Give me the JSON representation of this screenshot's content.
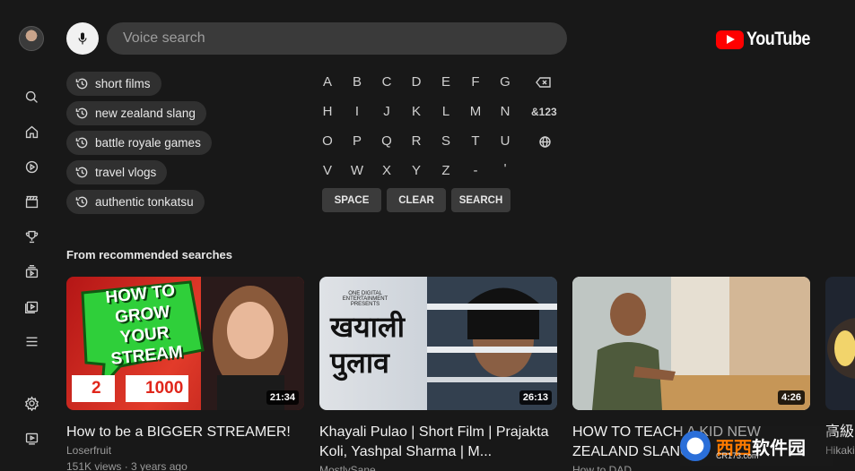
{
  "search": {
    "placeholder": "Voice search",
    "mic_icon": "microphone-icon"
  },
  "logo": {
    "text": "YouTube",
    "brand_color": "#ff0000"
  },
  "rail": {
    "items": [
      {
        "icon": "search-icon"
      },
      {
        "icon": "home-icon"
      },
      {
        "icon": "shorts-icon"
      },
      {
        "icon": "movies-icon"
      },
      {
        "icon": "trophy-icon"
      },
      {
        "icon": "subscriptions-icon"
      },
      {
        "icon": "library-icon"
      },
      {
        "icon": "menu-icon"
      },
      {
        "icon": "settings-icon"
      },
      {
        "icon": "cast-icon"
      }
    ]
  },
  "history": [
    {
      "label": "short films"
    },
    {
      "label": "new zealand slang"
    },
    {
      "label": "battle royale games"
    },
    {
      "label": "travel vlogs"
    },
    {
      "label": "authentic tonkatsu"
    }
  ],
  "keyboard": {
    "rows": [
      [
        "A",
        "B",
        "C",
        "D",
        "E",
        "F",
        "G"
      ],
      [
        "H",
        "I",
        "J",
        "K",
        "L",
        "M",
        "N"
      ],
      [
        "O",
        "P",
        "Q",
        "R",
        "S",
        "T",
        "U"
      ],
      [
        "V",
        "W",
        "X",
        "Y",
        "Z",
        "-",
        "'"
      ]
    ],
    "symbols_label": "&123",
    "space_label": "SPACE",
    "clear_label": "CLEAR",
    "search_label": "SEARCH"
  },
  "recommended": {
    "title": "From recommended searches",
    "videos": [
      {
        "title": "How to be a BIGGER STREAMER!",
        "channel": "Loserfruit",
        "meta": "151K views · 3 years ago",
        "duration": "21:34",
        "thumb_text_1": "HOW TO",
        "thumb_text_2": "GROW YOUR",
        "thumb_text_3": "STREAM",
        "thumb_stat_1": "2",
        "thumb_stat_2": "1000"
      },
      {
        "title": "Khayali Pulao | Short Film | Prajakta Koli, Yashpal Sharma | M...",
        "channel": "MostlySane",
        "meta": "",
        "duration": "26:13",
        "thumb_text_1": "खयाली",
        "thumb_text_2": "पुलाव",
        "thumb_small": "ONE DIGITAL ENTERTAINMENT PRESENTS"
      },
      {
        "title": "HOW TO TEACH A KID NEW ZEALAND SLANG",
        "channel": "How to DAD",
        "meta": "",
        "duration": "4:26"
      },
      {
        "title": "高級 美味",
        "channel": "Hikaki",
        "meta": ""
      }
    ]
  },
  "watermark": {
    "text_a": "西西",
    "text_b": "软件园",
    "url": "CR173.com"
  }
}
